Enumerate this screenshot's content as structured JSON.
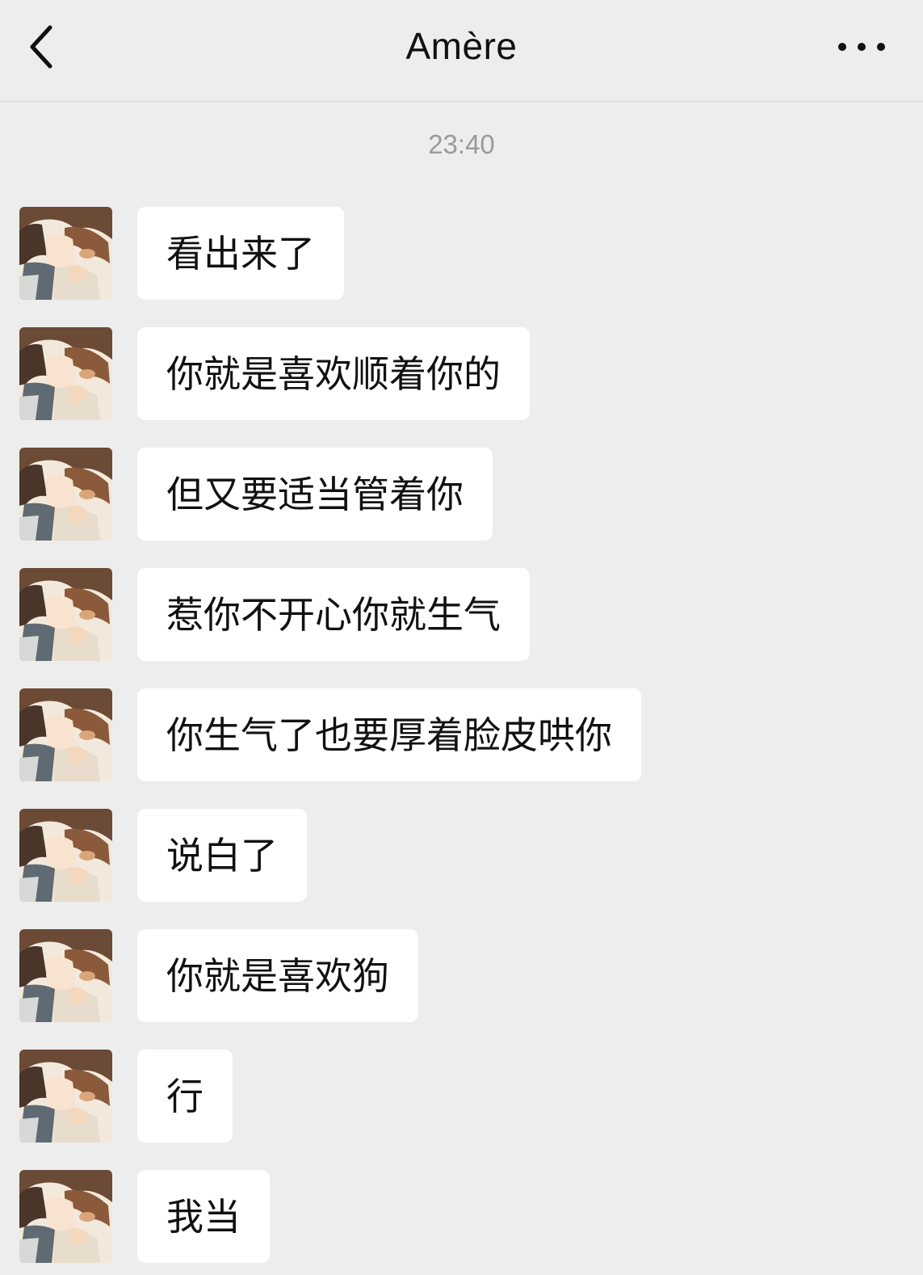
{
  "header": {
    "title": "Amère",
    "back_icon": "chevron-left-icon",
    "more_icon": "more-horizontal-icon"
  },
  "timestamp": "23:40",
  "messages": [
    {
      "text": "看出来了"
    },
    {
      "text": "你就是喜欢顺着你的"
    },
    {
      "text": "但又要适当管着你"
    },
    {
      "text": "惹你不开心你就生气"
    },
    {
      "text": "你生气了也要厚着脸皮哄你"
    },
    {
      "text": "说白了"
    },
    {
      "text": "你就是喜欢狗"
    },
    {
      "text": "行"
    },
    {
      "text": "我当"
    }
  ],
  "colors": {
    "background": "#ededed",
    "bubble": "#ffffff",
    "timestamp": "#9a9a9a",
    "text": "#111111"
  }
}
